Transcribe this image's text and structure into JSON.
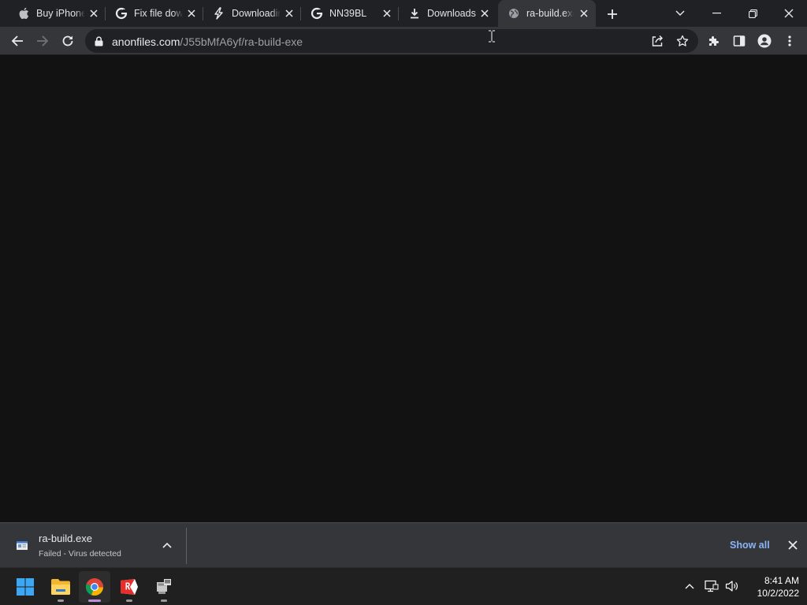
{
  "browser": {
    "tabs": [
      {
        "label": "Buy iPhone",
        "icon": "apple-icon",
        "active": false
      },
      {
        "label": "Fix file download",
        "icon": "google-icon",
        "active": false
      },
      {
        "label": "Downloading",
        "icon": "lightning-icon",
        "active": false
      },
      {
        "label": "NN39BL",
        "icon": "google-icon",
        "active": false
      },
      {
        "label": "Downloads",
        "icon": "download-icon",
        "active": false
      },
      {
        "label": "ra-build.exe",
        "icon": "globe-icon",
        "active": true
      }
    ],
    "address_bar": {
      "host": "anonfiles.com",
      "path": "/J55bMfA6yf/ra-build-exe"
    }
  },
  "download_shelf": {
    "item": {
      "filename": "ra-build.exe",
      "status": "Failed - Virus detected"
    },
    "show_all_label": "Show all"
  },
  "taskbar": {
    "apps": [
      "start-button",
      "file-explorer",
      "chrome",
      "yandex-browser",
      "network-tool"
    ],
    "clock": {
      "time": "8:41 AM",
      "date": "10/2/2022"
    }
  },
  "colors": {
    "tabstrip": "#202124",
    "toolbar": "#35363a",
    "content": "#121212",
    "link": "#8ab4f8"
  }
}
